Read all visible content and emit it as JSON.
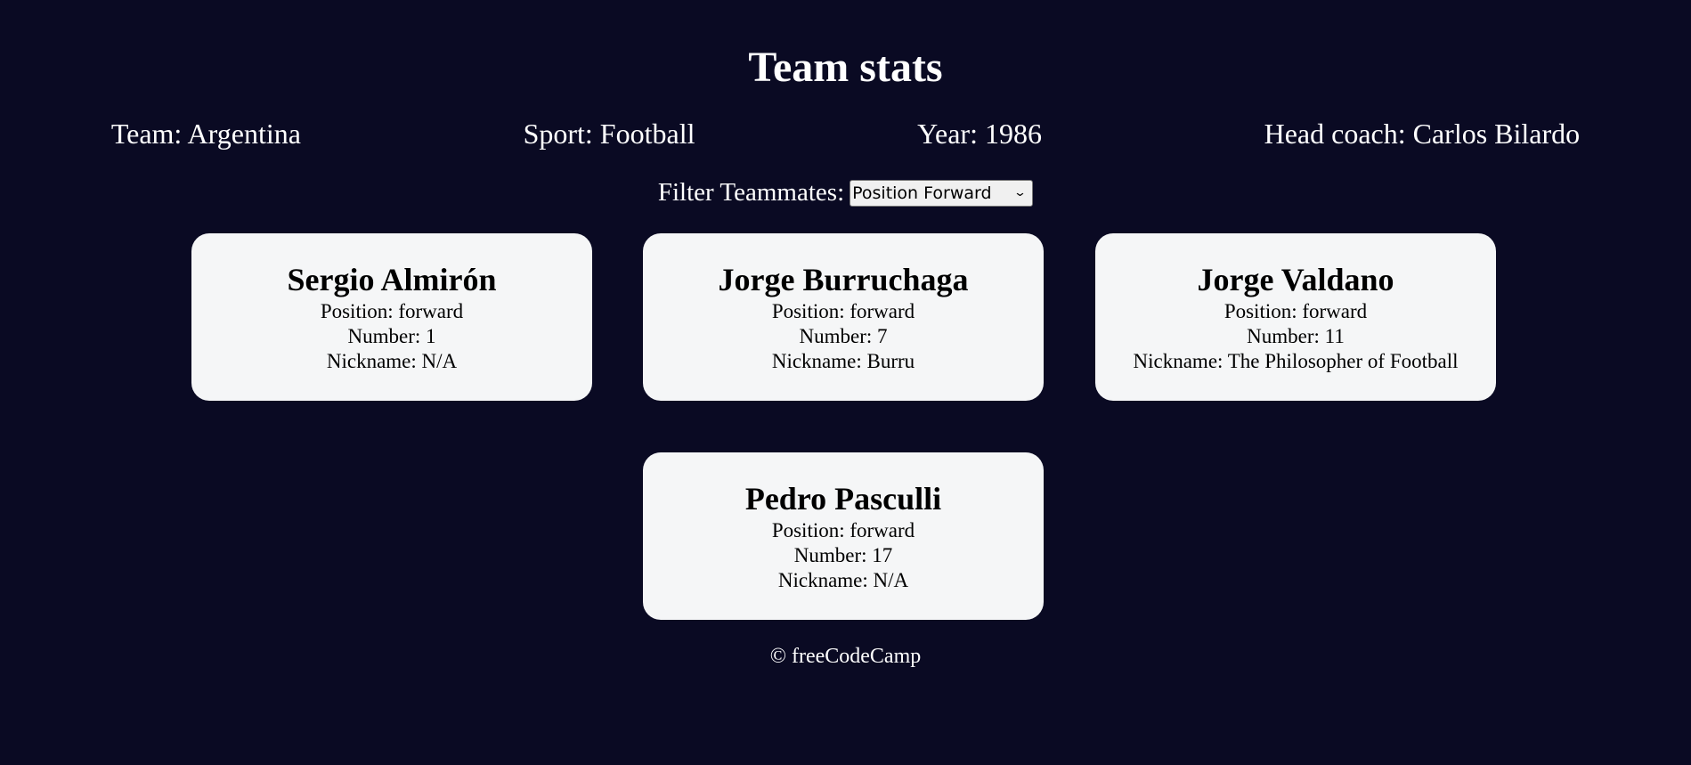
{
  "header": {
    "title": "Team stats"
  },
  "team_info": {
    "team": "Team: Argentina",
    "sport": "Sport: Football",
    "year": "Year: 1986",
    "head_coach": "Head coach: Carlos Bilardo"
  },
  "filter": {
    "label": "Filter Teammates:",
    "selected": "Position Forward"
  },
  "players": [
    {
      "name": "Sergio Almirón",
      "position": "Position: forward",
      "number": "Number: 1",
      "nickname": "Nickname: N/A"
    },
    {
      "name": "Jorge Burruchaga",
      "position": "Position: forward",
      "number": "Number: 7",
      "nickname": "Nickname: Burru"
    },
    {
      "name": "Jorge Valdano",
      "position": "Position: forward",
      "number": "Number: 11",
      "nickname": "Nickname: The Philosopher of Football"
    },
    {
      "name": "Pedro Pasculli",
      "position": "Position: forward",
      "number": "Number: 17",
      "nickname": "Nickname: N/A"
    }
  ],
  "footer": {
    "text": "© freeCodeCamp"
  },
  "colors": {
    "background": "#0a0a23",
    "card": "#f5f6f7"
  }
}
